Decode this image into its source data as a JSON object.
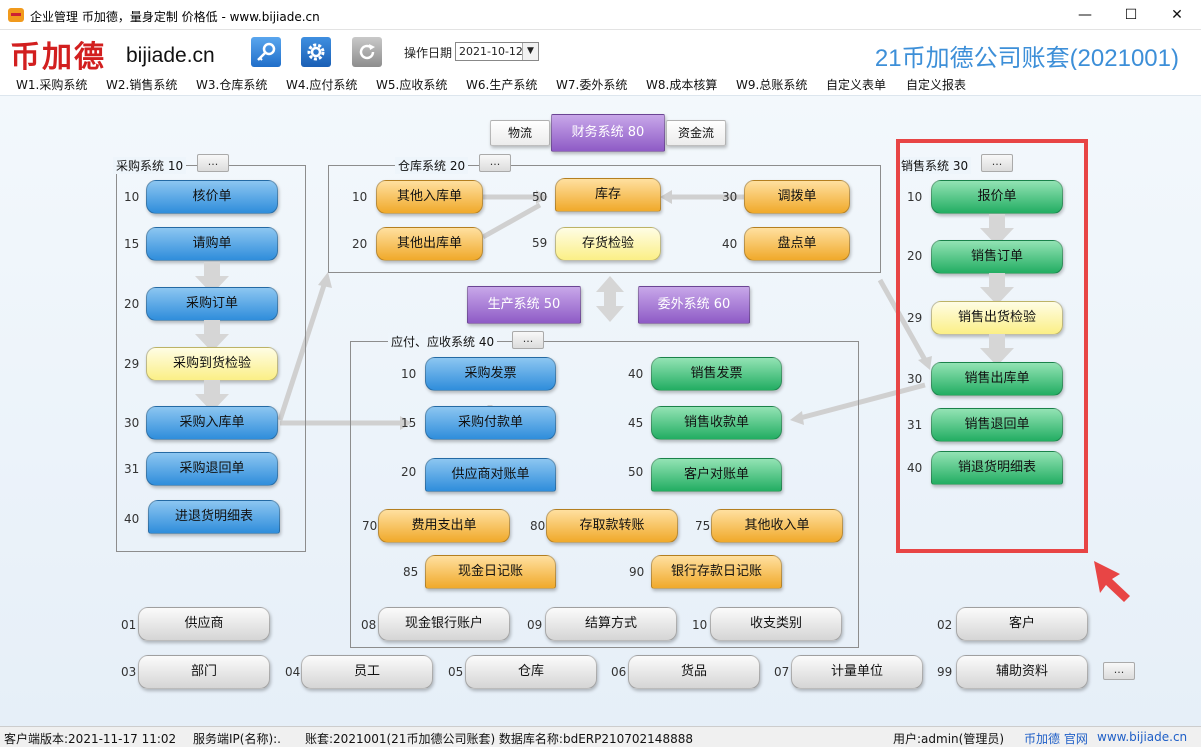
{
  "window": {
    "title": "企业管理 币加德，量身定制 价格低 - www.bijiade.cn",
    "minimize": "—",
    "maximize": "☐",
    "close": "✕"
  },
  "header": {
    "logo_cn": "币加德",
    "logo_en": "bijiade.cn",
    "op_date_label": "操作日期",
    "op_date_value": "2021-10-12",
    "company": "21币加德公司账套(2021001)"
  },
  "menu": [
    "W1.采购系统",
    "W2.销售系统",
    "W3.仓库系统",
    "W4.应付系统",
    "W5.应收系统",
    "W6.生产系统",
    "W7.委外系统",
    "W8.成本核算",
    "W9.总账系统",
    "自定义表单",
    "自定义报表"
  ],
  "top": {
    "wuliu": "物流",
    "finance": "财务系统 80",
    "zijin": "资金流"
  },
  "purchase": {
    "title": "采购系统  10",
    "more": "...",
    "nums": [
      "10",
      "15",
      "20",
      "29",
      "30",
      "31",
      "40"
    ],
    "nodes": [
      "核价单",
      "请购单",
      "采购订单",
      "采购到货检验",
      "采购入库单",
      "采购退回单",
      "进退货明细表"
    ]
  },
  "warehouse": {
    "title": "仓库系统  20",
    "more": "...",
    "nums": [
      "10",
      "20",
      "50",
      "59",
      "30",
      "40"
    ],
    "nodes": [
      "其他入库单",
      "其他出库单",
      "库存",
      "存货检验",
      "调拨单",
      "盘点单"
    ]
  },
  "middle": {
    "production": "生产系统 50",
    "outsource": "委外系统 60"
  },
  "ar_ap": {
    "title": "应付、应收系统  40",
    "more": "...",
    "nums": [
      "10",
      "15",
      "20",
      "40",
      "45",
      "50",
      "70",
      "80",
      "75",
      "85",
      "90"
    ],
    "nodes": [
      "采购发票",
      "采购付款单",
      "供应商对账单",
      "销售发票",
      "销售收款单",
      "客户对账单",
      "费用支出单",
      "存取款转账",
      "其他收入单",
      "现金日记账",
      "银行存款日记账"
    ]
  },
  "sales": {
    "title": "销售系统  30",
    "more": "...",
    "nums": [
      "10",
      "20",
      "29",
      "30",
      "31",
      "40"
    ],
    "nodes": [
      "报价单",
      "销售订单",
      "销售出货检验",
      "销售出库单",
      "销售退回单",
      "销退货明细表"
    ]
  },
  "basics": {
    "row1_nums": [
      "01",
      "08",
      "09",
      "10",
      "02"
    ],
    "row1": [
      "供应商",
      "现金银行账户",
      "结算方式",
      "收支类别",
      "客户"
    ],
    "row2_nums": [
      "03",
      "04",
      "05",
      "06",
      "07",
      "99"
    ],
    "row2": [
      "部门",
      "员工",
      "仓库",
      "货品",
      "计量单位",
      "辅助资料"
    ],
    "more": "..."
  },
  "status": {
    "client_version": "客户端版本:2021-11-17 11:02",
    "server": "服务端IP(名称):.",
    "account": "账套:2021001(21币加德公司账套) 数据库名称:bdERP210702148888",
    "user": "用户:admin(管理员)",
    "link1": "币加德 官网",
    "link2": "www.bijiade.cn"
  },
  "colors": {
    "blue": "#2f8ddb",
    "green": "#22ad62",
    "orange": "#f0a92a",
    "yellow": "#fbef86",
    "purple": "#8e5bc6",
    "highlight": "#e84545",
    "company_title": "#3d8fd8",
    "logo_red": "#d21f1f"
  }
}
